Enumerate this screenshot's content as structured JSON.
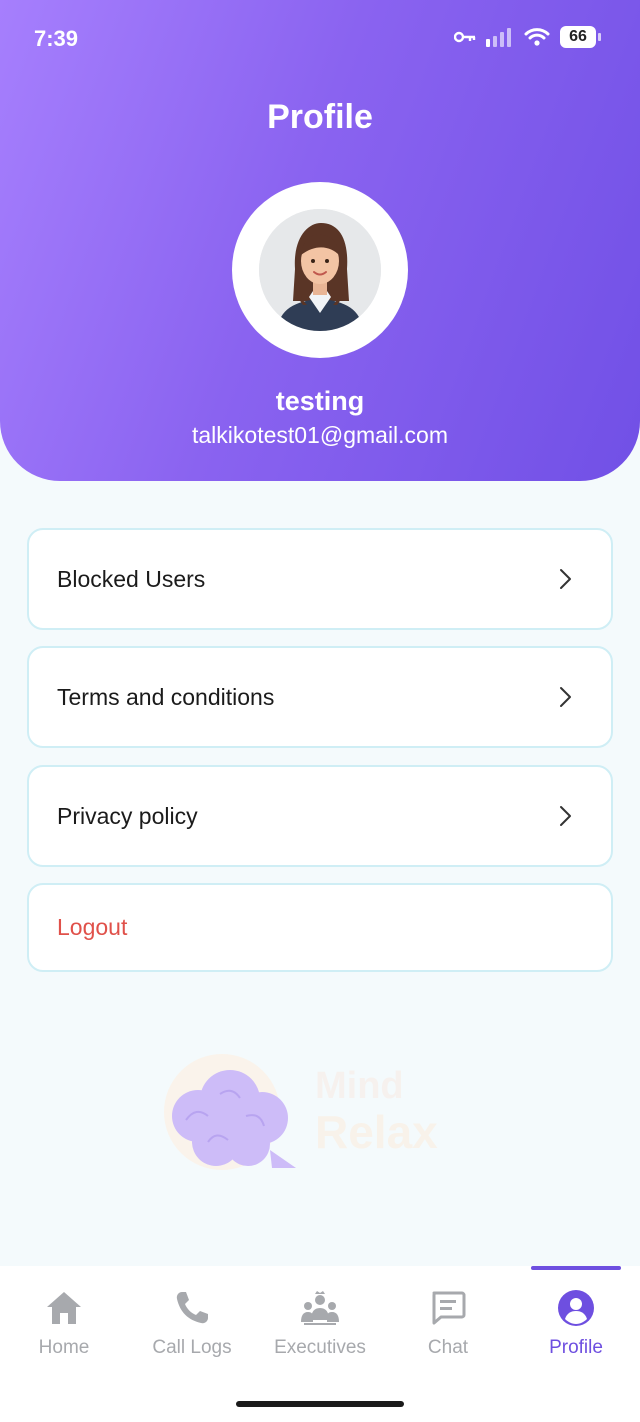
{
  "status_bar": {
    "time": "7:39",
    "battery": "66"
  },
  "header": {
    "title": "Profile"
  },
  "user": {
    "name": "testing",
    "email": "talkikotest01@gmail.com"
  },
  "menu": [
    {
      "label": "Blocked Users",
      "has_chevron": true
    },
    {
      "label": "Terms and conditions",
      "has_chevron": true
    },
    {
      "label": "Privacy policy",
      "has_chevron": true
    },
    {
      "label": "Logout",
      "has_chevron": false
    }
  ],
  "watermark": {
    "text_line1": "Mind",
    "text_line2": "Relax"
  },
  "bottom_nav": [
    {
      "label": "Home",
      "icon": "home-icon"
    },
    {
      "label": "Call Logs",
      "icon": "phone-icon"
    },
    {
      "label": "Executives",
      "icon": "group-icon"
    },
    {
      "label": "Chat",
      "icon": "chat-icon"
    },
    {
      "label": "Profile",
      "icon": "profile-icon",
      "active": true
    }
  ],
  "colors": {
    "accent": "#6e4fe0",
    "gradient_start": "#a67ffd",
    "gradient_end": "#7150e6",
    "logout": "#e0514a",
    "inactive": "#a7a9ad"
  }
}
